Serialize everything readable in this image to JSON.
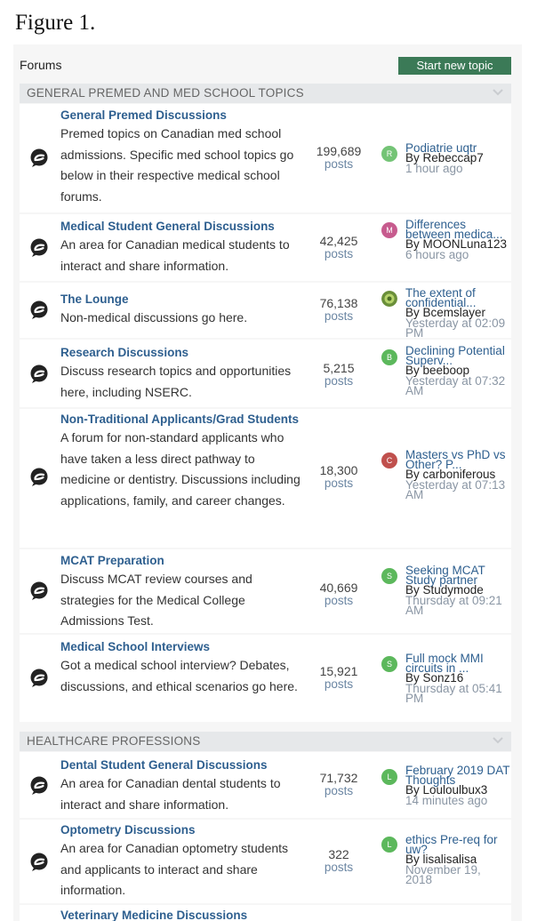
{
  "figure_caption": "Figure 1.",
  "header": {
    "title": "Forums",
    "new_topic_label": "Start new topic"
  },
  "categories": [
    {
      "title": "GENERAL PREMED AND MED SCHOOL TOPICS"
    },
    {
      "title": "HEALTHCARE PROFESSIONS"
    }
  ],
  "forums": [
    {
      "title": "General Premed Discussions",
      "description": "Premed topics on Canadian med school admissions. Specific med school topics go below in their respective medical school forums.",
      "count": "199,689",
      "posts_label": "posts",
      "avatar_letter": "R",
      "avatar_color": "#74c476",
      "latest_title": "Podiatrie uqtr",
      "latest_by": "By Rebeccap7",
      "latest_time": "1 hour ago"
    },
    {
      "title": "Medical Student General Discussions",
      "description": "An area for Canadian medical students to interact and share information.",
      "count": "42,425",
      "posts_label": "posts",
      "avatar_letter": "M",
      "avatar_color": "#c75b8e",
      "latest_title": "Differences between medica...",
      "latest_by": "By MOONLuna123",
      "latest_time": "6 hours ago"
    },
    {
      "title": "The Lounge",
      "description": "Non-medical discussions go here.",
      "count": "76,138",
      "posts_label": "posts",
      "avatar_letter": "",
      "avatar_color": "#6a8f3a",
      "latest_title": "The extent of confidential...",
      "latest_by": "By Bcemslayer",
      "latest_time": "Yesterday at 02:09 PM"
    },
    {
      "title": "Research Discussions",
      "description": "Discuss research topics and opportunities here, including NSERC.",
      "count": "5,215",
      "posts_label": "posts",
      "avatar_letter": "B",
      "avatar_color": "#5cb85c",
      "latest_title": "Declining Potential Superv...",
      "latest_by": "By beeboop",
      "latest_time": "Yesterday at 07:32 AM"
    },
    {
      "title": "Non-Traditional Applicants/Grad Students",
      "description": "A forum for non-standard applicants who have taken a less direct pathway to medicine or dentistry. Discussions including applications, family, and career changes.",
      "count": "18,300",
      "posts_label": "posts",
      "avatar_letter": "C",
      "avatar_color": "#c0504d",
      "latest_title": "Masters vs PhD vs Other? P...",
      "latest_by": "By carboniferous",
      "latest_time": "Yesterday at 07:13 AM"
    },
    {
      "title": "MCAT Preparation",
      "description": "Discuss MCAT review courses and strategies for the Medical College Admissions Test.",
      "count": "40,669",
      "posts_label": "posts",
      "avatar_letter": "S",
      "avatar_color": "#5cb85c",
      "latest_title": "Seeking MCAT Study partner",
      "latest_by": "By Studymode",
      "latest_time": "Thursday at 09:21 AM"
    },
    {
      "title": "Medical School Interviews",
      "description": "Got a medical school interview? Debates, discussions, and ethical scenarios go here.",
      "count": "15,921",
      "posts_label": "posts",
      "avatar_letter": "S",
      "avatar_color": "#5cb85c",
      "latest_title": "Full mock MMI circuits in ...",
      "latest_by": "By Sonz16",
      "latest_time": "Thursday at 05:41 PM"
    },
    {
      "title": "Dental Student General Discussions",
      "description": "An area for Canadian dental students to interact and share information.",
      "count": "71,732",
      "posts_label": "posts",
      "avatar_letter": "L",
      "avatar_color": "#5cb85c",
      "latest_title": "February 2019 DAT Thoughts",
      "latest_by": "By Louloulbux3",
      "latest_time": "14 minutes ago"
    },
    {
      "title": "Optometry Discussions",
      "description": "An area for Canadian optometry students and applicants to interact and share information.",
      "count": "322",
      "posts_label": "posts",
      "avatar_letter": "L",
      "avatar_color": "#5cb85c",
      "latest_title": "ethics Pre-req for uw?",
      "latest_by": "By lisalisalisa",
      "latest_time": "November 19, 2018"
    },
    {
      "title": "Veterinary Medicine Discussions",
      "description": "",
      "count": "",
      "posts_label": "",
      "avatar_letter": "",
      "avatar_color": "#ffffff",
      "latest_title": "",
      "latest_by": "",
      "latest_time": ""
    }
  ],
  "icons": {
    "forum_icon": "speech-bubble-icon",
    "category_toggle": "chevron-down-icon"
  }
}
